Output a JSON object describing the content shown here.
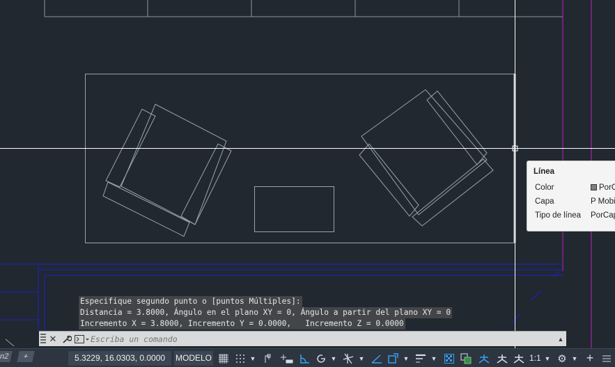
{
  "command_history": [
    "Especifique segundo punto o [puntos Múltiples]:",
    "Distancia = 3.8000, Ángulo en el plano XY = 0, Ángulo a partir del plano XY = 0",
    "Incremento X = 3.8000, Incremento Y = 0.0000,   Incremento Z = 0.0000"
  ],
  "command_line": {
    "placeholder": "Escriba un comando"
  },
  "tooltip": {
    "title": "Línea",
    "rows": [
      {
        "label": "Color",
        "value": "PorCapa"
      },
      {
        "label": "Capa",
        "value": "P Mobiliario"
      },
      {
        "label": "Tipo de línea",
        "value": "PorCapa"
      }
    ]
  },
  "status_bar": {
    "layout_tab": "n2",
    "add_tab": "+",
    "coordinates": "5.3229, 16.0303, 0.0000",
    "model_label": "MODELO",
    "scale": "1:1"
  },
  "colors": {
    "background": "#212830",
    "geometry": "#9aa3ad",
    "crosshair": "#ffffff",
    "blue_walls": "#1f1fd0",
    "magenta_lines": "#c020c0"
  }
}
